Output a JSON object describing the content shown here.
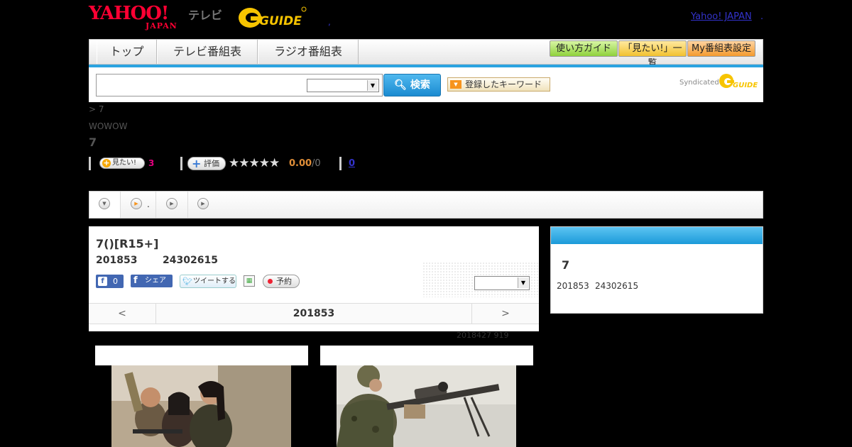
{
  "header": {
    "yahoo": "YAHOO!",
    "japan": "JAPAN",
    "tv": "テレビ",
    "brand": "G-GUIDE",
    "yahoo_japan_link": "Yahoo! JAPAN",
    "dot": ".",
    "mini_dot": ","
  },
  "gnav": {
    "tabs": [
      "トップ",
      "テレビ番組表",
      "ラジオ番組表"
    ],
    "buttons": [
      "使い方ガイド",
      "「見たい!」一覧",
      "My番組表設定"
    ]
  },
  "search": {
    "button": "検索",
    "keyword_button": "登録したキーワード",
    "syndicated": "Syndicated"
  },
  "breadcrumb": "> 7",
  "channel": "WOWOW",
  "title": "7",
  "actions": {
    "mitai_label": "見たい!",
    "mitai_count": "3",
    "hyoka_label": "評価",
    "stars": "★★★★★",
    "score": "0.00",
    "score_count": "/0",
    "zero_link": "0"
  },
  "tabs": {
    "dot": "."
  },
  "detail": {
    "program_title": "7()[R15+]",
    "date": "201853",
    "time": "24302615",
    "fb_count": "0",
    "fb_share": "シェア",
    "tweet": "ツイートする",
    "reserve": "予約",
    "pager_prev": "<",
    "pager_mid": "201853",
    "pager_next": ">"
  },
  "update_note": "2018427  919",
  "side": {
    "title": "7",
    "date": "201853",
    "time": "24302615"
  },
  "colors": {
    "accent_blue": "#2aa3e0",
    "mitai_count": "#e4007f",
    "score": "#e08e38",
    "link": "#3333cc"
  }
}
